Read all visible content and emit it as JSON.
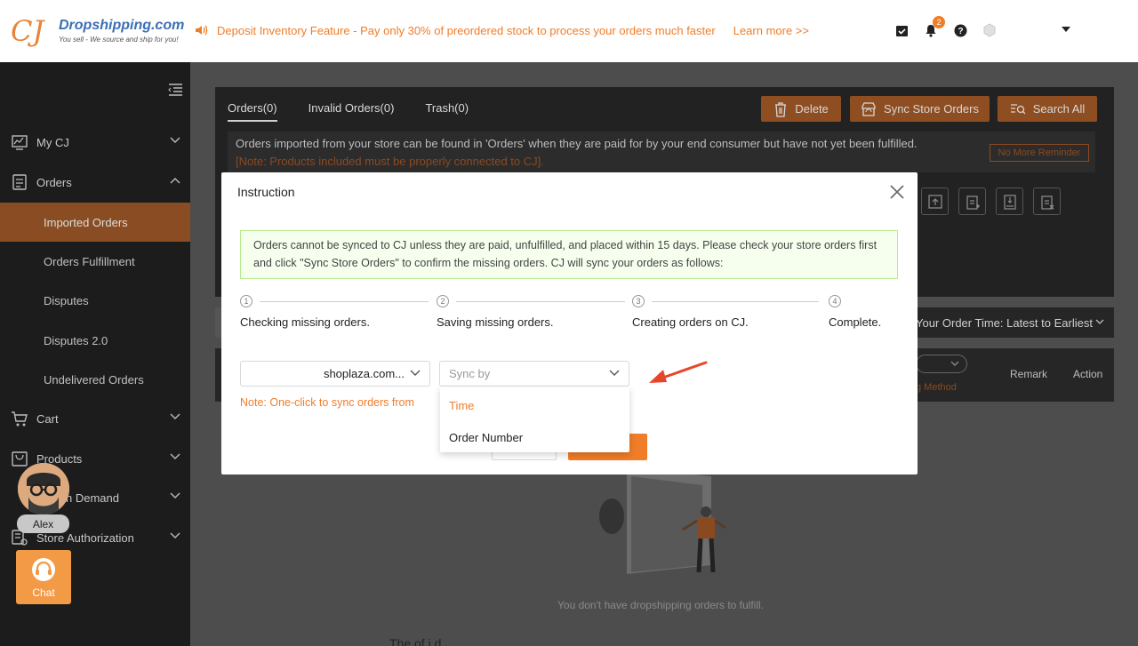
{
  "brand": {
    "logo_letters": "CJ",
    "name": "Dropshipping.com",
    "tagline": "You sell - We source and ship for you!"
  },
  "announcement": {
    "text": "Deposit Inventory Feature - Pay only 30% of preordered stock to process your orders much faster",
    "link": "Learn more >>"
  },
  "header": {
    "notification_count": "2"
  },
  "sidebar": {
    "items": [
      {
        "label": "My CJ"
      },
      {
        "label": "Orders"
      },
      {
        "label": "Cart"
      },
      {
        "label": "Products"
      },
      {
        "label": "n Demand"
      },
      {
        "label": "Store Authorization"
      }
    ],
    "sub_items": [
      {
        "label": "Imported Orders"
      },
      {
        "label": "Orders Fulfillment"
      },
      {
        "label": "Disputes"
      },
      {
        "label": "Disputes 2.0"
      },
      {
        "label": "Undelivered Orders"
      }
    ]
  },
  "chat": {
    "agent_name": "Alex",
    "label": "Chat"
  },
  "orders_page": {
    "tabs": [
      {
        "label": "Orders(0)"
      },
      {
        "label": "Invalid Orders(0)"
      },
      {
        "label": "Trash(0)"
      }
    ],
    "buttons": {
      "delete": "Delete",
      "sync": "Sync Store Orders",
      "search_all": "Search All"
    },
    "notice": "Orders imported from your store can be found in 'Orders' when they are paid for by your end consumer but have not yet been fulfilled.",
    "notice_warn": "[Note: Products included must be properly connected to CJ].",
    "no_more_reminder": "No More Reminder",
    "sort_label": "Your Order Time: Latest to Earliest",
    "columns": {
      "remark": "Remark",
      "action": "Action",
      "method": "g Method"
    },
    "empty_text": "You don't have dropshipping orders to fulfill.",
    "bottom_text": "The        of i         d"
  },
  "modal": {
    "title": "Instruction",
    "info": "Orders cannot be synced to CJ unless they are paid, unfulfilled, and placed within 15 days. Please check your store orders first and click \"Sync Store Orders\" to confirm the missing orders. CJ will sync your orders as follows:",
    "steps": [
      {
        "num": "1",
        "label": "Checking missing orders."
      },
      {
        "num": "2",
        "label": "Saving missing orders."
      },
      {
        "num": "3",
        "label": "Creating orders on CJ."
      },
      {
        "num": "4",
        "label": "Complete."
      }
    ],
    "store_value": "shoplaza.com...",
    "sync_placeholder": "Sync by",
    "note": "Note: One-click to sync orders from",
    "dropdown_options": [
      {
        "label": "Time",
        "selected": true
      },
      {
        "label": "Order Number",
        "selected": false
      }
    ]
  },
  "colors": {
    "accent": "#f07d29",
    "sidebar_bg": "#1c1c1c",
    "info_bg": "#f6ffed"
  }
}
